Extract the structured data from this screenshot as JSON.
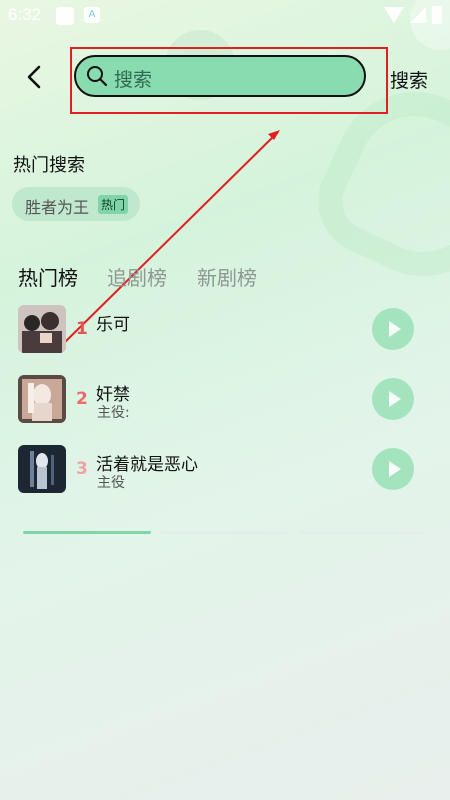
{
  "status_bar": {
    "time": "6:32"
  },
  "header": {
    "search_placeholder": "搜索",
    "search_button": "搜索"
  },
  "hot_search": {
    "title": "热门搜索",
    "chips": [
      {
        "label": "胜者为王",
        "badge": "热门"
      }
    ]
  },
  "tabs": [
    "热门榜",
    "追剧榜",
    "新剧榜"
  ],
  "ranking": [
    {
      "rank": "1",
      "title": "乐可",
      "subtitle": "",
      "rank_color": "#e55353"
    },
    {
      "rank": "2",
      "title": "奸禁",
      "subtitle": "主役:",
      "rank_color": "#ec6b6b"
    },
    {
      "rank": "3",
      "title": "活着就是恶心",
      "subtitle": "主役",
      "rank_color": "#f0a2a2"
    }
  ],
  "colors": {
    "accent": "#7fd5a8",
    "search_fill": "#88dcb0",
    "annotation_red": "#e02020"
  }
}
